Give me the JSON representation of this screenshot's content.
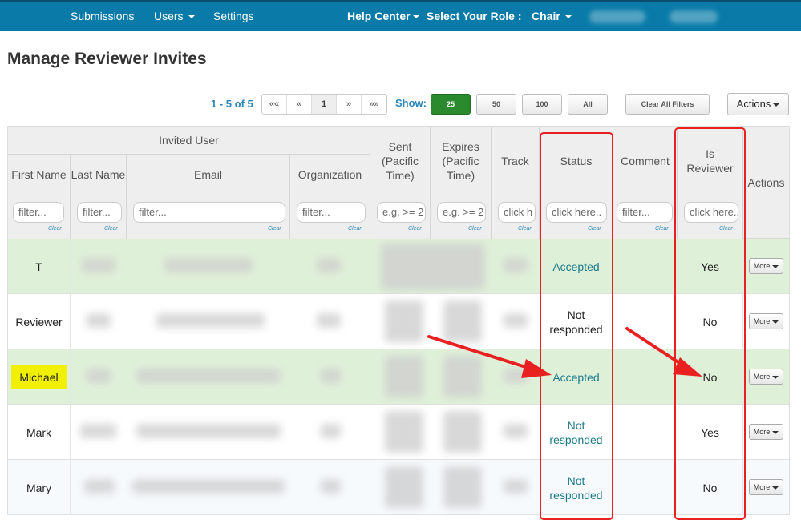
{
  "nav": {
    "submissions": "Submissions",
    "users": "Users",
    "settings": "Settings",
    "help_center": "Help Center",
    "select_role_label": "Select Your Role :",
    "role": "Chair"
  },
  "page": {
    "title": "Manage Reviewer Invites"
  },
  "pagination": {
    "count_text": "1 - 5 of 5",
    "buttons": [
      "««",
      "«",
      "1",
      "»",
      "»»"
    ],
    "show_label": "Show:",
    "page_sizes": [
      "25",
      "50",
      "100",
      "All"
    ],
    "active_page_size": "25",
    "clear_filters": "Clear All Filters",
    "actions": "Actions"
  },
  "table": {
    "group_header": "Invited User",
    "headers": {
      "first_name": "First Name",
      "last_name": "Last Name",
      "email": "Email",
      "organization": "Organization",
      "sent": "Sent (Pacific Time)",
      "expires": "Expires (Pacific Time)",
      "track": "Track",
      "status": "Status",
      "comment": "Comment",
      "is_reviewer": "Is Reviewer",
      "actions": "Actions"
    },
    "filters": {
      "first_name": "filter...",
      "last_name": "filter...",
      "email": "filter...",
      "organization": "filter...",
      "sent": "e.g. >= 2",
      "expires": "e.g. >= 2",
      "track": "click h",
      "status": "click here..",
      "comment": "filter...",
      "is_reviewer": "click here.."
    },
    "clear_label": "Clear",
    "more_label": "More",
    "rows": [
      {
        "first_name": "T",
        "status": "Accepted",
        "is_reviewer": "Yes"
      },
      {
        "first_name": "Reviewer",
        "status": "Not responded",
        "is_reviewer": "No"
      },
      {
        "first_name": "Michael",
        "status": "Accepted",
        "is_reviewer": "No"
      },
      {
        "first_name": "Mark",
        "status": "Not responded",
        "is_reviewer": "Yes"
      },
      {
        "first_name": "Mary",
        "status": "Not responded",
        "is_reviewer": "No"
      }
    ]
  },
  "colors": {
    "navbar": "#0a7ba8",
    "accepted_row": "#dff0d8",
    "link": "#1a7a8a",
    "annotation": "#e82020",
    "highlight": "#f0f000",
    "active_button": "#2b8a2e"
  }
}
